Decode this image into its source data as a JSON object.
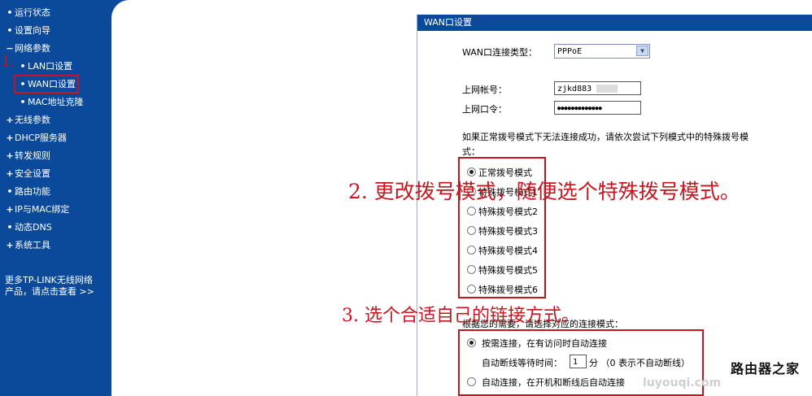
{
  "sidebar": {
    "items": [
      {
        "bullet": "•",
        "label": "运行状态"
      },
      {
        "bullet": "•",
        "label": "设置向导"
      },
      {
        "bullet": "−",
        "label": "网络参数"
      },
      {
        "bullet": "•",
        "label": "LAN口设置"
      },
      {
        "bullet": "•",
        "label": "WAN口设置"
      },
      {
        "bullet": "•",
        "label": "MAC地址克隆"
      },
      {
        "bullet": "+",
        "label": "无线参数"
      },
      {
        "bullet": "+",
        "label": "DHCP服务器"
      },
      {
        "bullet": "+",
        "label": "转发规则"
      },
      {
        "bullet": "+",
        "label": "安全设置"
      },
      {
        "bullet": "•",
        "label": "路由功能"
      },
      {
        "bullet": "+",
        "label": "IP与MAC绑定"
      },
      {
        "bullet": "•",
        "label": "动态DNS"
      },
      {
        "bullet": "+",
        "label": "系统工具"
      }
    ],
    "more_line1": "更多TP-LINK无线网络",
    "more_line2": "产品，请点击查看 >>"
  },
  "panel": {
    "title": "WAN口设置",
    "conn_type_label": "WAN口连接类型：",
    "conn_type_value": "PPPoE",
    "account_label": "上网帐号：",
    "account_value": "zjkd883",
    "password_label": "上网口令：",
    "password_value": "●●●●●●●●●●●●●",
    "hint_line1": "如果正常拨号模式下无法连接成功，请依次尝试下列模式中的特殊拨号模",
    "hint_line2": "式：",
    "dial_modes": [
      "正常拨号模式",
      "特殊拨号模式1",
      "特殊拨号模式2",
      "特殊拨号模式3",
      "特殊拨号模式4",
      "特殊拨号模式5",
      "特殊拨号模式6"
    ],
    "conn_mode_label": "根据您的需要，请选择对应的连接模式：",
    "on_demand": "按需连接，在有访问时自动连接",
    "idle_label": "自动断线等待时间：",
    "idle_value": "1",
    "idle_unit": "分 （0 表示不自动断线）",
    "auto_connect": "自动连接，在开机和断线后自动连接"
  },
  "annotations": {
    "step1": "1.",
    "step2": "2. 更改拨号模式，随便选个特殊拨号模式。",
    "step3": "3. 选个合适自己的链接方式。"
  },
  "watermark": "路由器之家",
  "watermark_url": "luyouqi.com",
  "colors": {
    "sidebar_bg": "#0b4a9a",
    "highlight": "#c8141e"
  }
}
